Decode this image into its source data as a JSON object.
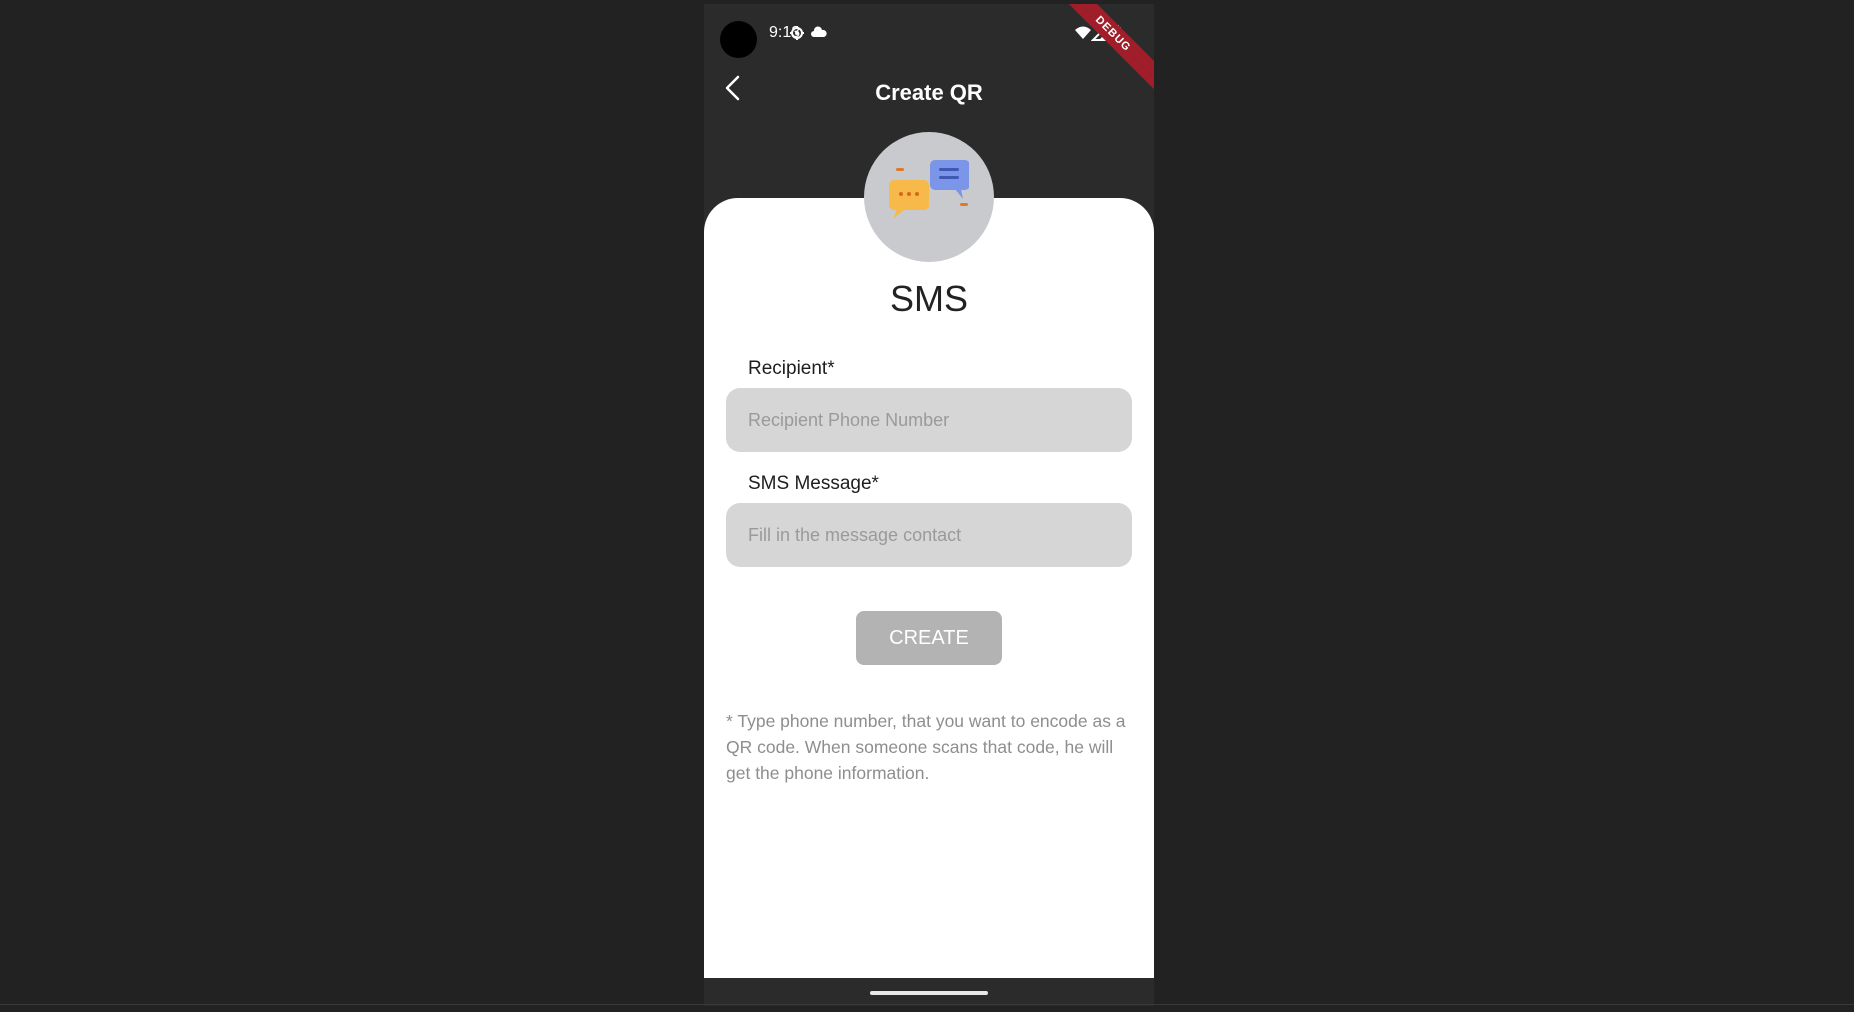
{
  "status_bar": {
    "time": "9:13",
    "icons": [
      "settings-icon",
      "cloud-icon",
      "wifi-icon",
      "signal-icon",
      "battery-icon"
    ],
    "debug_banner": "DEBUG"
  },
  "app_bar": {
    "title": "Create QR",
    "back_icon": "chevron-left-icon"
  },
  "form": {
    "avatar_icon": "chat-bubbles-icon",
    "heading": "SMS",
    "recipient_label": "Recipient*",
    "recipient_placeholder": "Recipient Phone Number",
    "recipient_value": "",
    "message_label": "SMS Message*",
    "message_placeholder": "Fill in the message contact",
    "message_value": "",
    "create_label": "CREATE",
    "help_text": "* Type phone number, that you want to encode as a QR code. When someone scans that code, he will get the phone information."
  },
  "colors": {
    "background": "#222222",
    "app_bar": "#2b2b2b",
    "card": "#ffffff",
    "input_fill": "#d6d6d6",
    "button_disabled": "#b3b3b3",
    "debug_ribbon": "#a01d2a"
  }
}
